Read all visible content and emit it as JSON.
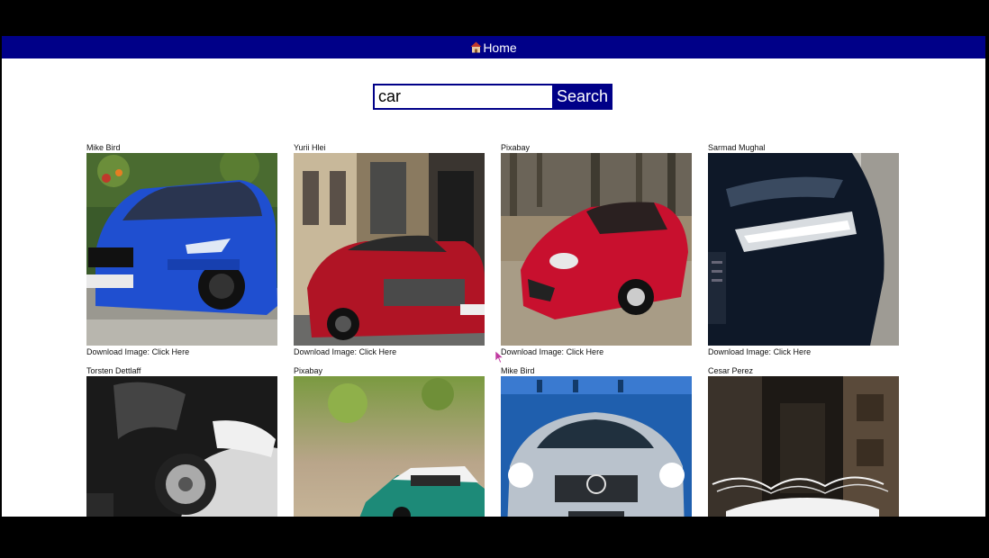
{
  "nav": {
    "home_label": "Home",
    "icon": "house-icon"
  },
  "search": {
    "value": "car",
    "button_label": "Search"
  },
  "download_prefix": "Download Image:",
  "download_link": "Click Here",
  "cards": [
    {
      "author": "Mike Bird",
      "photo": "blue sports sedan"
    },
    {
      "author": "Yurii Hlei",
      "photo": "red sports car street"
    },
    {
      "author": "Pixabay",
      "photo": "red sports car motion"
    },
    {
      "author": "Sarmad Mughal",
      "photo": "dark car headlight"
    },
    {
      "author": "Torsten Dettlaff",
      "photo": "black car closeup"
    },
    {
      "author": "Pixabay",
      "photo": "teal vintage car"
    },
    {
      "author": "Mike Bird",
      "photo": "silver car headlights"
    },
    {
      "author": "Cesar Perez",
      "photo": "white car light painting"
    }
  ],
  "colors": {
    "nav_bg": "#000088",
    "accent": "#000088"
  }
}
